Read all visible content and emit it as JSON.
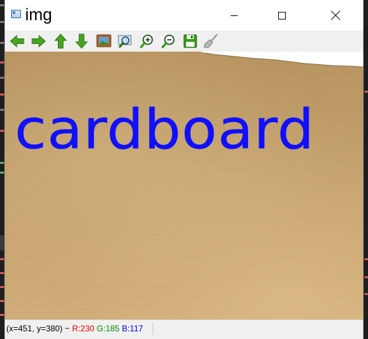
{
  "window": {
    "title": "img",
    "icon": "opencv-window-icon"
  },
  "title_controls": {
    "minimize": "minimize-icon",
    "maximize": "maximize-icon",
    "close": "close-icon"
  },
  "toolbar": {
    "buttons": [
      {
        "name": "pan-left-button",
        "icon": "arrow-left-icon"
      },
      {
        "name": "pan-right-button",
        "icon": "arrow-right-icon"
      },
      {
        "name": "pan-up-button",
        "icon": "arrow-up-icon"
      },
      {
        "name": "pan-down-button",
        "icon": "arrow-down-icon"
      },
      {
        "name": "zoom-original-button",
        "icon": "image-icon"
      },
      {
        "name": "zoom-fit-button",
        "icon": "zoom-fit-icon"
      },
      {
        "name": "zoom-in-button",
        "icon": "zoom-in-icon"
      },
      {
        "name": "zoom-out-button",
        "icon": "zoom-out-icon"
      },
      {
        "name": "save-button",
        "icon": "save-disk-icon"
      },
      {
        "name": "properties-button",
        "icon": "brush-icon"
      }
    ]
  },
  "image": {
    "overlay_text": "cardboard",
    "overlay_color": "#1010ff",
    "surface": "cardboard-texture"
  },
  "status": {
    "coords": "(x=451, y=380) ~ ",
    "r": "R:230",
    "g": "G:185",
    "b": "B:117"
  },
  "colors": {
    "red": "#e00000",
    "green": "#008a00",
    "blue": "#0000d0",
    "toolbar_icon_green": "#3d9a1e"
  }
}
